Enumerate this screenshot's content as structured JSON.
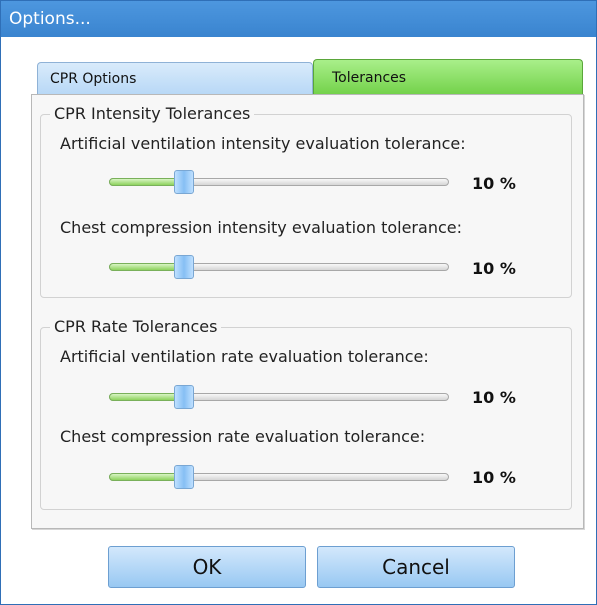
{
  "window": {
    "title": "Options..."
  },
  "tabs": [
    {
      "label": "CPR Options",
      "selected": false
    },
    {
      "label": "Tolerances",
      "selected": true
    }
  ],
  "groups": [
    {
      "title": "CPR Intensity Tolerances",
      "sliders": [
        {
          "label": "Artificial ventilation intensity evaluation tolerance:",
          "value_text": "10 %",
          "fraction": 0.22
        },
        {
          "label": "Chest compression intensity evaluation tolerance:",
          "value_text": "10 %",
          "fraction": 0.22
        }
      ]
    },
    {
      "title": "CPR Rate Tolerances",
      "sliders": [
        {
          "label": "Artificial ventilation rate evaluation tolerance:",
          "value_text": "10 %",
          "fraction": 0.22
        },
        {
          "label": "Chest compression rate evaluation tolerance:",
          "value_text": "10 %",
          "fraction": 0.22
        }
      ]
    }
  ],
  "buttons": {
    "ok": "OK",
    "cancel": "Cancel"
  },
  "colors": {
    "title_bar": "#3a84cf",
    "selected_tab": "#74d24b",
    "slider_fill": "#8ed25e"
  }
}
